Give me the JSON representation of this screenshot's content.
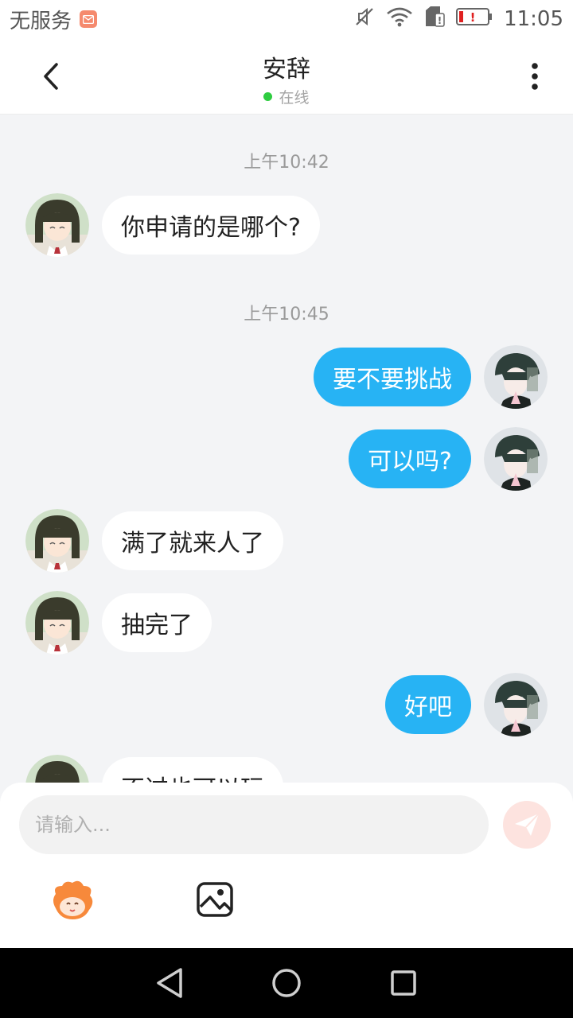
{
  "status_bar": {
    "carrier": "无服务",
    "time": "11:05",
    "icons": [
      "mail-notification-icon",
      "mute-icon",
      "wifi-icon",
      "sim-alert-icon",
      "battery-low-icon"
    ]
  },
  "header": {
    "back_icon": "chevron-left-icon",
    "title": "安辞",
    "status": "在线",
    "status_color": "#2ecc40",
    "more_icon": "more-vertical-icon"
  },
  "messages": {
    "time_1": "上午10:42",
    "time_2": "上午10:45",
    "items": [
      {
        "side": "left",
        "text": "你申请的是哪个?"
      },
      {
        "side": "right",
        "text": "要不要挑战"
      },
      {
        "side": "right",
        "text": "可以吗?"
      },
      {
        "side": "left",
        "text": "满了就来人了"
      },
      {
        "side": "left",
        "text": "抽完了"
      },
      {
        "side": "right",
        "text": "好吧"
      },
      {
        "side": "left",
        "text": "不过也可以玩"
      }
    ]
  },
  "input": {
    "placeholder": "请输入...",
    "send_icon": "send-icon",
    "emoji_icon": "mascot-emoji-icon",
    "image_icon": "image-icon"
  },
  "nav": {
    "icons": [
      "back-triangle-icon",
      "home-circle-icon",
      "recents-square-icon"
    ]
  },
  "colors": {
    "accent": "#27b3f4",
    "background": "#f3f4f6",
    "send_button": "#fde3df"
  }
}
